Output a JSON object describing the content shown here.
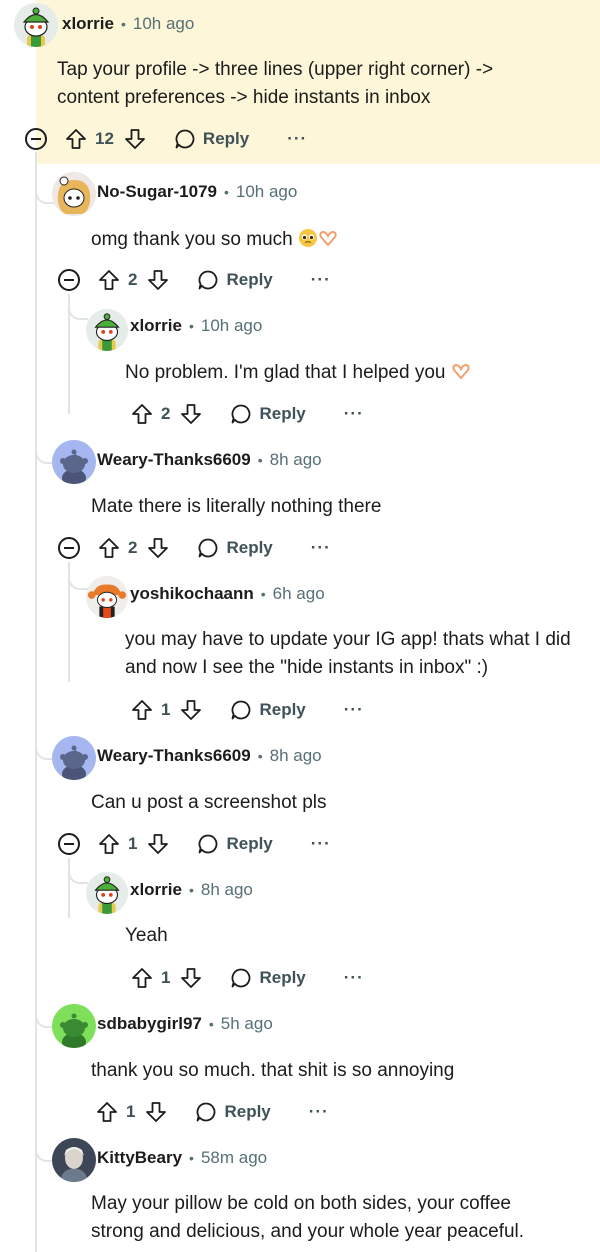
{
  "comments": [
    {
      "user": "xlorrie",
      "time": "10h ago",
      "text": [
        "Tap your profile -> three lines (upper right corner) ->",
        "content preferences -> hide instants in inbox"
      ],
      "votes": "12",
      "reply": "Reply",
      "more": "···",
      "avatar": "snoo-green-hat"
    },
    {
      "user": "No-Sugar-1079",
      "time": "10h ago",
      "text": [
        "omg thank you so much"
      ],
      "votes": "2",
      "reply": "Reply",
      "more": "···",
      "avatar": "snoo-blonde"
    },
    {
      "user": "xlorrie",
      "time": "10h ago",
      "text": [
        "No problem. I'm glad that I helped you"
      ],
      "votes": "2",
      "reply": "Reply",
      "more": "···",
      "avatar": "snoo-green-hat"
    },
    {
      "user": "Weary-Thanks6609",
      "time": "8h ago",
      "text": [
        "Mate there is literally nothing there"
      ],
      "votes": "2",
      "reply": "Reply",
      "more": "···",
      "avatar": "snoo-default-blue"
    },
    {
      "user": "yoshikochaann",
      "time": "6h ago",
      "text": [
        "you may have to update your IG app! thats what I did",
        "and now I see the \"hide instants in inbox\" :)"
      ],
      "votes": "1",
      "reply": "Reply",
      "more": "···",
      "avatar": "snoo-orange-hair"
    },
    {
      "user": "Weary-Thanks6609",
      "time": "8h ago",
      "text": [
        "Can u post a screenshot pls"
      ],
      "votes": "1",
      "reply": "Reply",
      "more": "···",
      "avatar": "snoo-default-blue"
    },
    {
      "user": "xlorrie",
      "time": "8h ago",
      "text": [
        "Yeah"
      ],
      "votes": "1",
      "reply": "Reply",
      "more": "···",
      "avatar": "snoo-green-hat"
    },
    {
      "user": "sdbabygirl97",
      "time": "5h ago",
      "text": [
        "thank you so much. that shit is so annoying"
      ],
      "votes": "1",
      "reply": "Reply",
      "more": "···",
      "avatar": "snoo-default-green"
    },
    {
      "user": "KittyBeary",
      "time": "58m ago",
      "text": [
        "May your pillow be cold on both sides, your coffee",
        "strong and delicious, and your whole year peaceful."
      ],
      "avatar": "photo-avatar"
    }
  ],
  "colors": {
    "highlight": "#fdf6d9",
    "thread_line": "#e0e4e6",
    "meta": "#576f76"
  }
}
